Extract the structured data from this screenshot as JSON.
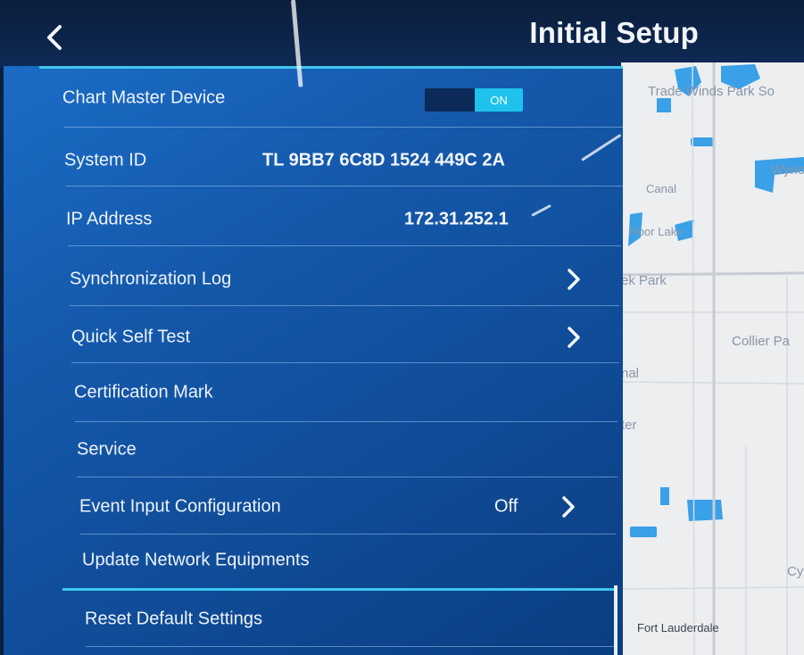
{
  "header": {
    "title": "Initial Setup",
    "back_icon": "chevron-left-icon"
  },
  "settings": {
    "chart_master": {
      "label": "Chart Master Device",
      "toggle_state": "ON"
    },
    "system_id": {
      "label": "System ID",
      "value": "TL 9BB7 6C8D 1524 449C 2A"
    },
    "ip_address": {
      "label": "IP Address",
      "value": "172.31.252.1"
    },
    "sync_log": {
      "label": "Synchronization Log",
      "icon": "chevron-right-icon"
    },
    "quick_self_test": {
      "label": "Quick Self Test",
      "icon": "chevron-right-icon"
    },
    "certification_mark": {
      "label": "Certification Mark"
    },
    "service": {
      "label": "Service"
    },
    "event_input": {
      "label": "Event Input Configuration",
      "value": "Off",
      "icon": "chevron-right-icon"
    },
    "update_network": {
      "label": "Update Network Equipments"
    },
    "reset_defaults": {
      "label": "Reset Default Settings"
    }
  },
  "map": {
    "labels": [
      "Trade Winds Park So",
      "Wyno",
      "Canal",
      "Floor Lake",
      "ek Park",
      "Collier Pa",
      "nal",
      "ter",
      "Cy",
      "Fort Lauderdale"
    ]
  },
  "colors": {
    "panel": "#1458aa",
    "accent": "#3fc6ef",
    "toggle_on": "#1ec2ec",
    "header": "#0b1d3c",
    "map_bg": "#eceef0",
    "water": "#3aa0e8"
  }
}
